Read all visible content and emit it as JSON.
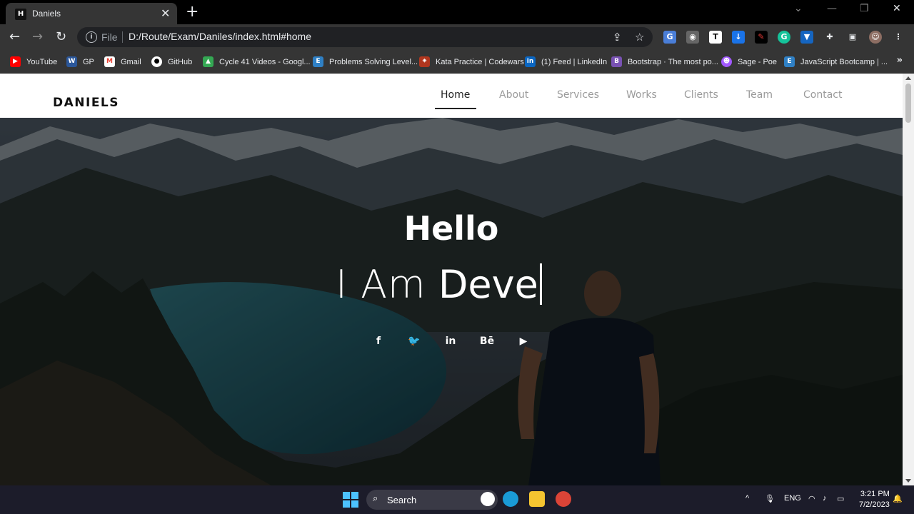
{
  "browser": {
    "tab_favicon": "H",
    "tab_title": "Daniels",
    "url_scheme": "File",
    "url": "D:/Route/Exam/Daniles/index.html#home"
  },
  "bookmarks": [
    {
      "label": "YouTube",
      "icon": "youtube-icon",
      "color": "#ff0000"
    },
    {
      "label": "GP",
      "icon": "word-icon",
      "color": "#2b579a"
    },
    {
      "label": "Gmail",
      "icon": "gmail-icon",
      "color": "#ea4335"
    },
    {
      "label": "GitHub",
      "icon": "github-icon",
      "color": "#ffffff"
    },
    {
      "label": "Cycle 41 Videos - Googl...",
      "icon": "drive-icon",
      "color": "#fbbc04"
    },
    {
      "label": "Problems Solving Level...",
      "icon": "e-icon",
      "color": "#2f80c5"
    },
    {
      "label": "Kata Practice | Codewars",
      "icon": "codewars-icon",
      "color": "#b1361e"
    },
    {
      "label": "(1) Feed | LinkedIn",
      "icon": "linkedin-icon",
      "color": "#0a66c2"
    },
    {
      "label": "Bootstrap · The most po...",
      "icon": "bootstrap-icon",
      "color": "#7952b3"
    },
    {
      "label": "Sage - Poe",
      "icon": "poe-icon",
      "color": "#a259ff"
    },
    {
      "label": "JavaScript Bootcamp | ...",
      "icon": "e-icon",
      "color": "#2f80c5"
    }
  ],
  "site": {
    "brand": "DANIELS",
    "menu": [
      "Home",
      "About",
      "Services",
      "Works",
      "Clients",
      "Team",
      "Contact"
    ],
    "active_menu": "Home",
    "hero_title": "Hello",
    "hero_prefix": "I Am",
    "hero_typed": "Deve",
    "social": [
      {
        "glyph": "f",
        "icon": "facebook-icon"
      },
      {
        "glyph": "🐦",
        "icon": "twitter-icon"
      },
      {
        "glyph": "in",
        "icon": "linkedin-icon"
      },
      {
        "glyph": "Bē",
        "icon": "behance-icon"
      },
      {
        "glyph": "▶",
        "icon": "youtube-icon"
      }
    ]
  },
  "taskbar": {
    "search_label": "Search",
    "lang": "ENG",
    "time": "3:21 PM",
    "date": "7/2/2023"
  }
}
